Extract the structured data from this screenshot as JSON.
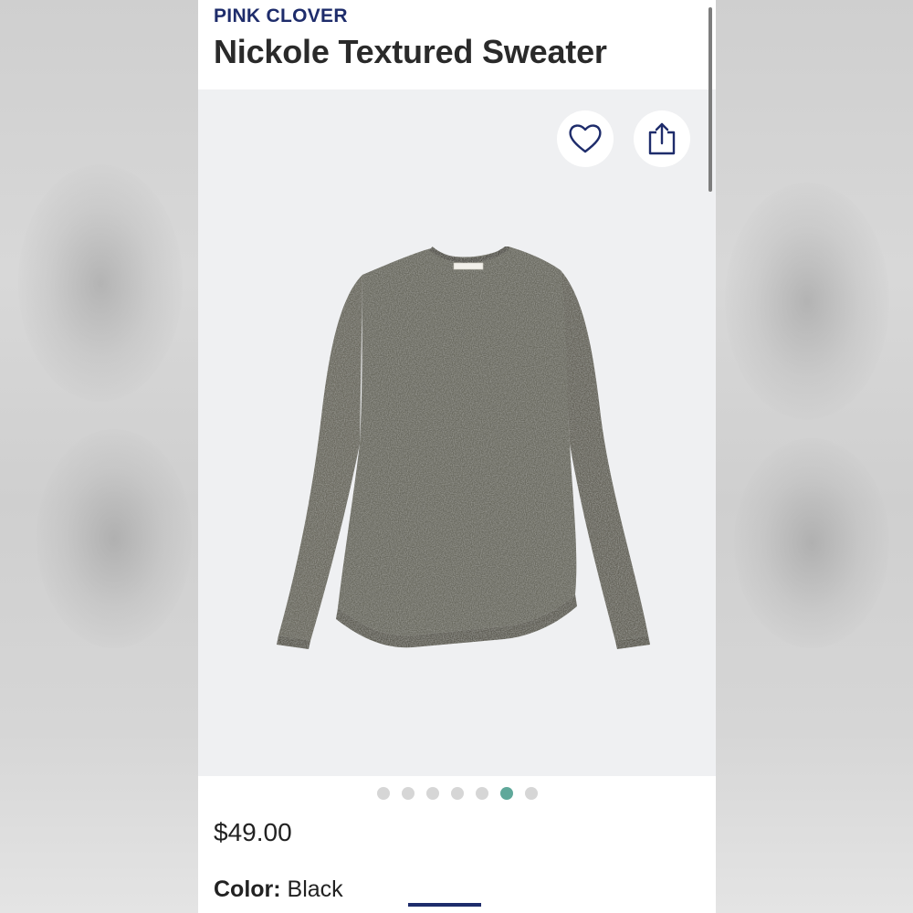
{
  "product": {
    "brand": "PINK CLOVER",
    "title": "Nickole Textured Sweater",
    "price": "$49.00",
    "color_label": "Color:",
    "color_value": "Black"
  },
  "actions": {
    "favorite_icon": "heart-outline-icon",
    "share_icon": "share-icon"
  },
  "carousel": {
    "total_images": 7,
    "active_index": 6
  },
  "colors": {
    "brand": "#1e2c6b",
    "active_dot": "#5fa89a",
    "inactive_dot": "#d6d6d6",
    "image_bg": "#eff0f2",
    "sweater": "#5e5d55"
  }
}
